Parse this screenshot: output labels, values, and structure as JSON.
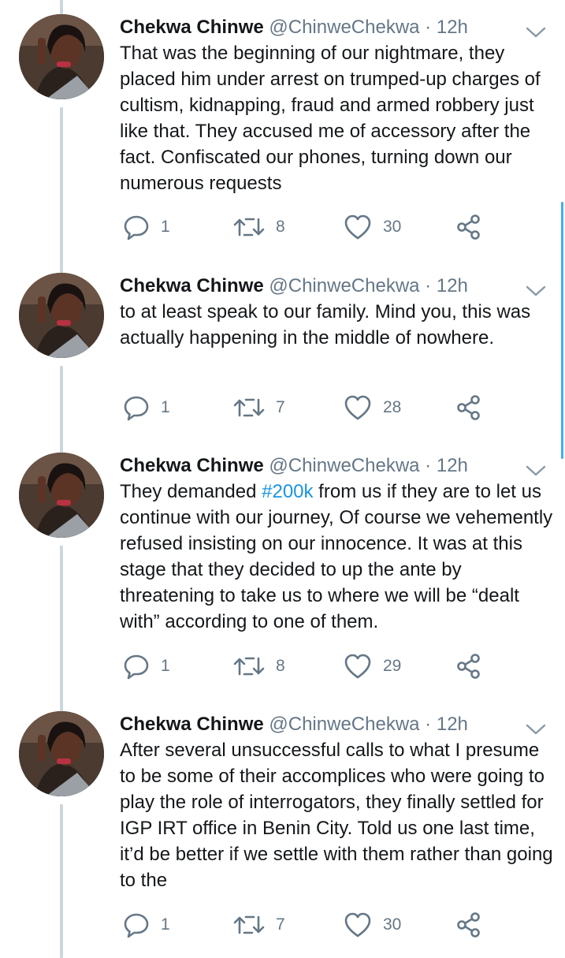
{
  "tweets": [
    {
      "author_name": "Chekwa Chinwe",
      "handle": "@ChinweChekwa",
      "separator": "·",
      "time": "12h",
      "text_parts": [
        "That was the beginning of our nightmare, they placed him under arrest on trumped-up charges of cultism, kidnapping, fraud and armed robbery just like that. They accused me of accessory after the fact. Confiscated our phones, turning down our numerous requests"
      ],
      "replies": "1",
      "retweets": "8",
      "likes": "30"
    },
    {
      "author_name": "Chekwa Chinwe",
      "handle": "@ChinweChekwa",
      "separator": "·",
      "time": "12h",
      "text_parts": [
        "to at least speak to our family. Mind you, this was actually happening in the middle of nowhere."
      ],
      "replies": "1",
      "retweets": "7",
      "likes": "28"
    },
    {
      "author_name": "Chekwa Chinwe",
      "handle": "@ChinweChekwa",
      "separator": "·",
      "time": "12h",
      "text_before": "They demanded ",
      "hashtag": "#200k",
      "text_after": " from us if they are to let us continue with our journey, Of course we vehemently refused insisting on our innocence. It was at this stage that they decided to up the ante by threatening to take us to where we will be “dealt with” according to one of them.",
      "replies": "1",
      "retweets": "8",
      "likes": "29"
    },
    {
      "author_name": "Chekwa Chinwe",
      "handle": "@ChinweChekwa",
      "separator": "·",
      "time": "12h",
      "text_parts": [
        "After several unsuccessful calls to what I presume to be some of their accomplices who were going to play the role of interrogators, they finally settled for IGP IRT office in Benin City. Told us one last time, it’d be better if we settle with them rather than going to the"
      ],
      "replies": "1",
      "retweets": "7",
      "likes": "30"
    }
  ],
  "icons": {
    "reply": "reply-icon",
    "retweet": "retweet-icon",
    "like": "heart-icon",
    "share": "share-icon",
    "menu": "chevron-down-icon"
  },
  "colors": {
    "text": "#14171a",
    "secondary": "#657786",
    "hashtag": "#1b95e0",
    "thread_line": "#ccd6dd",
    "scrollbar": "#1da1f2"
  }
}
